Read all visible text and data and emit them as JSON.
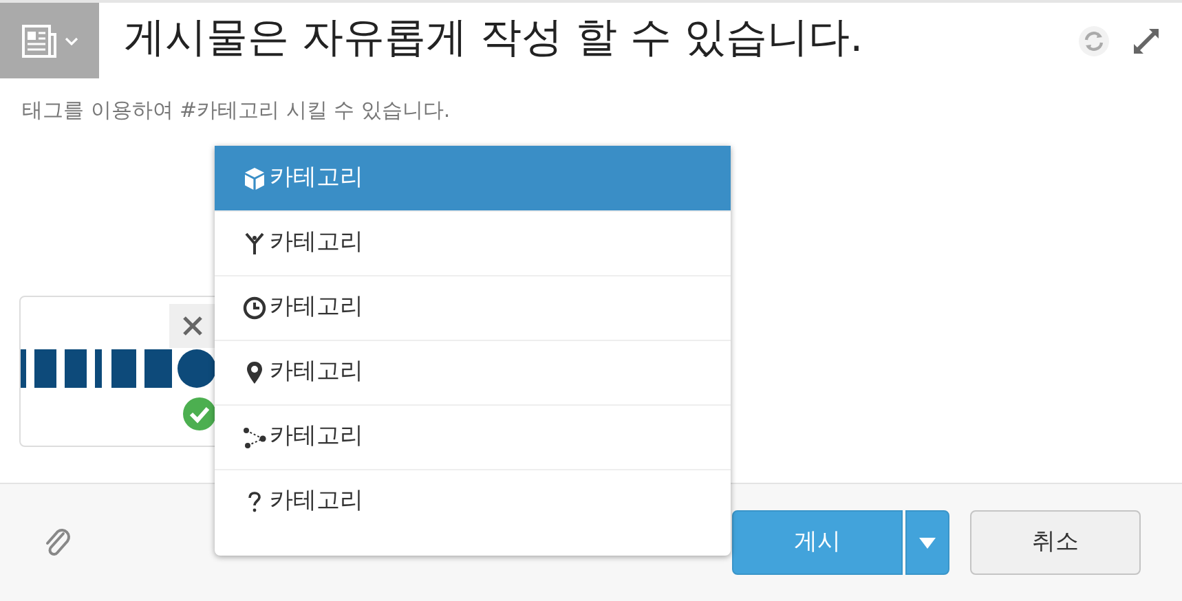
{
  "title": "게시물은 자유롭게 작성 할 수 있습니다.",
  "hint": "태그를 이용하여 #카테고리 시킬 수 있습니다.",
  "attachment": {
    "uploaded": true
  },
  "category_menu": [
    {
      "kind": "cube",
      "label": "카테고리",
      "selected": true
    },
    {
      "kind": "antenna",
      "label": "카테고리",
      "selected": false
    },
    {
      "kind": "clock",
      "label": "카테고리",
      "selected": false
    },
    {
      "kind": "pin",
      "label": "카테고리",
      "selected": false
    },
    {
      "kind": "nodes",
      "label": "카테고리",
      "selected": false
    },
    {
      "kind": "question",
      "label": "카테고리",
      "selected": false
    }
  ],
  "buttons": {
    "post": "게시",
    "cancel": "취소"
  }
}
